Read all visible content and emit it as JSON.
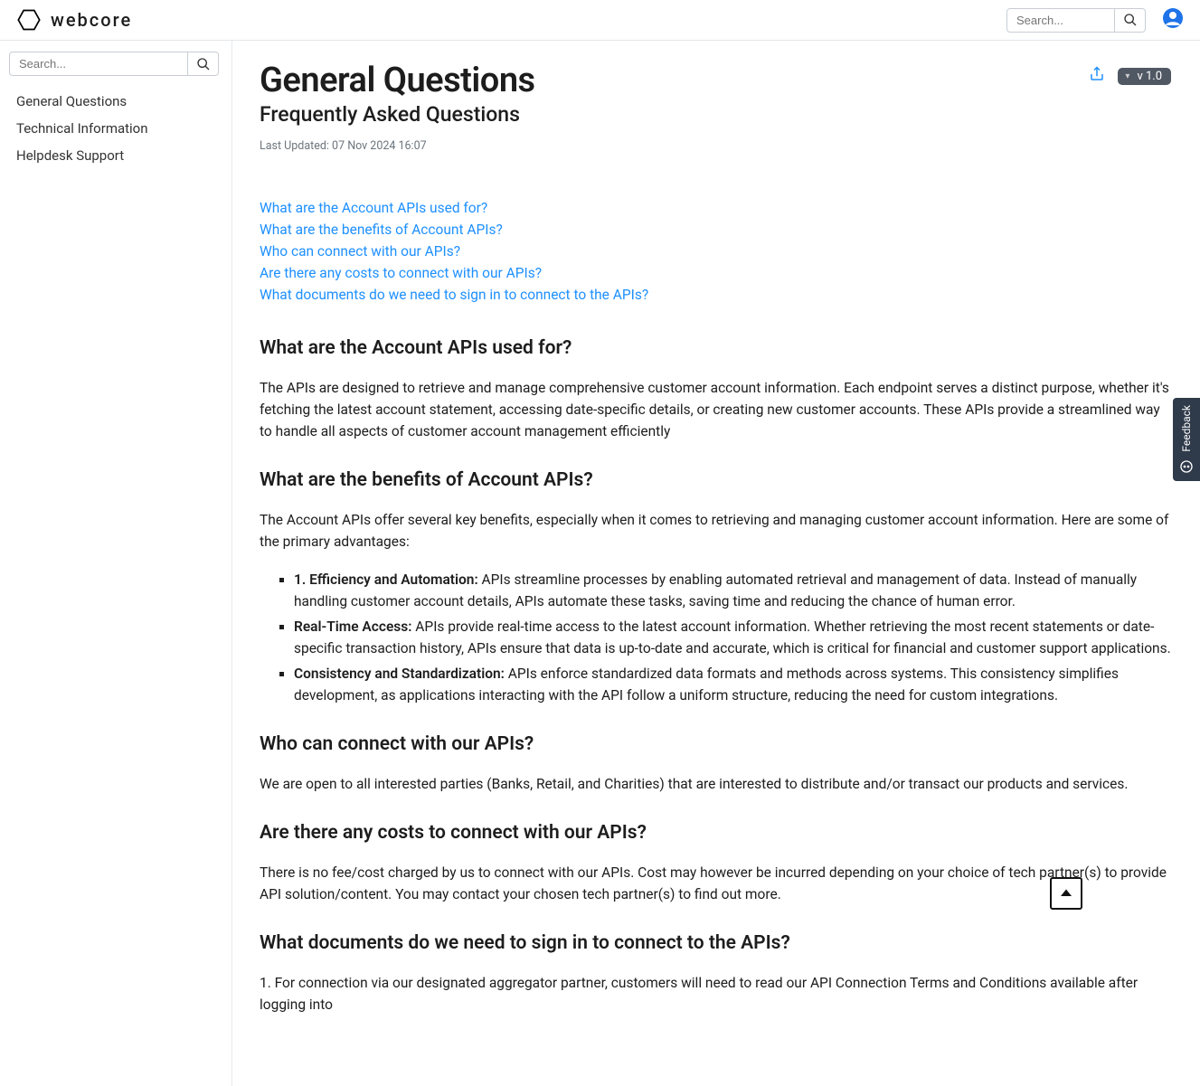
{
  "brand": "webcore",
  "header": {
    "search_placeholder": "Search..."
  },
  "sidebar": {
    "search_placeholder": "Search...",
    "items": [
      "General Questions",
      "Technical Information",
      "Helpdesk Support"
    ]
  },
  "page": {
    "title": "General Questions",
    "subtitle": "Frequently Asked Questions",
    "last_updated": "Last Updated: 07 Nov 2024 16:07",
    "version": "v 1.0"
  },
  "toc": [
    "What are the Account APIs used for?",
    "What are the benefits of Account APIs?",
    "Who can connect with our APIs?",
    "Are there any costs to connect with our APIs?",
    "What documents do we need to sign in to connect to the APIs?"
  ],
  "sections": {
    "q1h": "What are the Account APIs used for?",
    "q1p": "The APIs are designed to retrieve and manage comprehensive customer account information. Each endpoint serves a distinct purpose, whether it's fetching the latest account statement, accessing date-specific details, or creating new customer accounts. These APIs provide a streamlined way to handle all aspects of customer account management efficiently",
    "q2h": "What are the benefits of Account APIs?",
    "q2p": "The Account APIs offer several key benefits, especially when it comes to retrieving and managing customer account information. Here are some of the primary advantages:",
    "q2b1s": "1. Efficiency and Automation:",
    "q2b1": " APIs streamline processes by enabling automated retrieval and management of data. Instead of manually handling customer account details, APIs automate these tasks, saving time and reducing the chance of human error.",
    "q2b2s": "Real-Time Access:",
    "q2b2": " APIs provide real-time access to the latest account information. Whether retrieving the most recent statements or date-specific transaction history, APIs ensure that data is up-to-date and accurate, which is critical for financial and customer support applications.",
    "q2b3s": "Consistency and Standardization:",
    "q2b3": " APIs enforce standardized data formats and methods across systems. This consistency simplifies development, as applications interacting with the API follow a uniform structure, reducing the need for custom integrations.",
    "q3h": "Who can connect with our APIs?",
    "q3p": "We are open to all interested parties (Banks, Retail, and Charities) that are interested to distribute and/or transact our products and services.",
    "q4h": "Are there any costs to connect with our APIs?",
    "q4p": "There is no fee/cost charged by us to connect with our APIs. Cost may however be incurred depending on your choice of tech partner(s) to provide API solution/content. You may contact your chosen tech partner(s) to find out more.",
    "q5h": "What documents do we need to sign in to connect to the APIs?",
    "q5p": "1. For connection via our designated aggregator partner, customers will need to read our API Connection Terms and Conditions available after logging into"
  },
  "feedback": "Feedback"
}
